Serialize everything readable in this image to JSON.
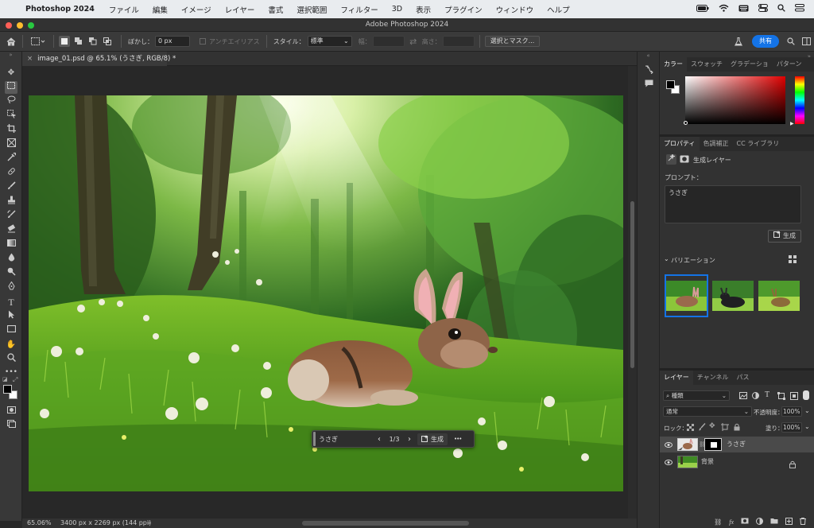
{
  "menubar": {
    "app_name": "Photoshop 2024",
    "items": [
      "ファイル",
      "編集",
      "イメージ",
      "レイヤー",
      "書式",
      "選択範囲",
      "フィルター",
      "3D",
      "表示",
      "プラグイン",
      "ウィンドウ",
      "ヘルプ"
    ]
  },
  "window": {
    "title": "Adobe Photoshop 2024"
  },
  "options_bar": {
    "feather_label": "ぼかし：",
    "feather_value": "0 px",
    "antialias_label": "アンチエイリアス",
    "style_label": "スタイル：",
    "style_value": "標準",
    "width_label": "幅：",
    "height_label": "高さ：",
    "select_mask_button": "選択とマスク...",
    "share_button": "共有"
  },
  "document_tab": {
    "title": "image_01.psd @ 65.1% (うさぎ, RGB/8) *"
  },
  "status_bar": {
    "zoom": "65.06%",
    "doc_info": "3400 px x 2269 px (144 ppi)"
  },
  "contextual_taskbar": {
    "prompt": "うさぎ",
    "variation_counter": "1/3",
    "generate_button": "生成",
    "more": "•••"
  },
  "color_panel": {
    "tabs": [
      "カラー",
      "スウォッチ",
      "グラデーショ",
      "パターン"
    ],
    "active_tab": 0,
    "foreground": "#000000",
    "background": "#ffffff",
    "hue_color": "#ff0000"
  },
  "properties_panel": {
    "tabs": [
      "プロパティ",
      "色調補正",
      "CC ライブラリ"
    ],
    "active_tab": 0,
    "layer_type": "生成レイヤー",
    "prompt_label": "プロンプト：",
    "prompt_value": "うさぎ",
    "generate_button": "生成",
    "variations_label": "バリエーション",
    "variations_count": 3,
    "selected_variation": 0
  },
  "layers_panel": {
    "tabs": [
      "レイヤー",
      "チャンネル",
      "パス"
    ],
    "active_tab": 0,
    "filter_kind": "種類",
    "blend_mode": "通常",
    "opacity_label": "不透明度：",
    "opacity_value": "100%",
    "lock_label": "ロック：",
    "fill_label": "塗り：",
    "fill_value": "100%",
    "layers": [
      {
        "name": "うさぎ",
        "visible": true,
        "selected": true
      },
      {
        "name": "背景",
        "visible": true,
        "selected": false,
        "locked": true
      }
    ]
  },
  "accent": "#1473e6"
}
